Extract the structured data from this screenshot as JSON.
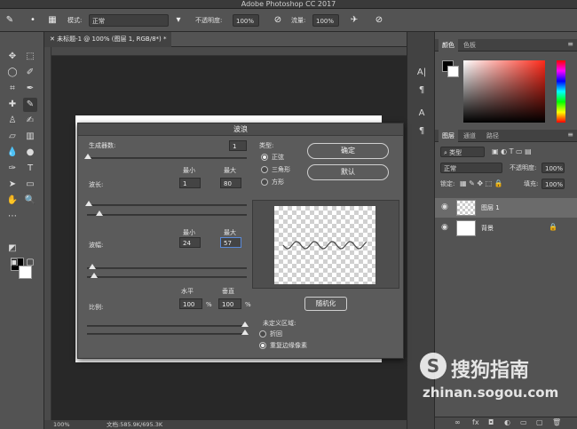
{
  "app": {
    "title": "Adobe Photoshop CC 2017"
  },
  "options_bar": {
    "mode_label": "模式:",
    "mode_value": "正常",
    "opacity_label": "不透明度:",
    "opacity_value": "100%",
    "flow_label": "流量:",
    "flow_value": "100%"
  },
  "document": {
    "tab_label": "未标题-1 @ 100% (图层 1, RGB/8*) *",
    "zoom": "100%",
    "doc_info": "文档:585.9K/695.3K"
  },
  "color_panel": {
    "tabs": [
      "颜色",
      "色板"
    ]
  },
  "layers_panel": {
    "tabs": [
      "图层",
      "通道",
      "路径"
    ],
    "filter_label": "类型",
    "blend_mode": "正常",
    "opacity_label": "不透明度:",
    "opacity_value": "100%",
    "lock_label": "锁定:",
    "fill_label": "填充:",
    "fill_value": "100%",
    "layers": [
      {
        "name": "图层 1",
        "selected": true
      },
      {
        "name": "背景",
        "selected": false
      }
    ]
  },
  "wave_dialog": {
    "title": "波浪",
    "generators_label": "生成器数:",
    "generators_value": "1",
    "min_label": "最小",
    "max_label": "最大",
    "wavelength_label": "波长:",
    "wavelength_min": "1",
    "wavelength_max": "80",
    "amplitude_label": "波幅:",
    "amplitude_min": "24",
    "amplitude_max": "57",
    "scale_label": "比例:",
    "horizontal_label": "水平",
    "vertical_label": "垂直",
    "scale_h": "100",
    "scale_v": "100",
    "percent": "%",
    "type_label": "类型:",
    "type_options": [
      "正弦",
      "三角形",
      "方形"
    ],
    "ok_label": "确定",
    "default_label": "默认",
    "randomize_label": "随机化",
    "undefined_label": "未定义区域:",
    "undefined_options": [
      "折回",
      "重复边缘像素"
    ]
  },
  "watermark": {
    "title": "搜狗指南",
    "url": "zhinan.sogou.com"
  }
}
